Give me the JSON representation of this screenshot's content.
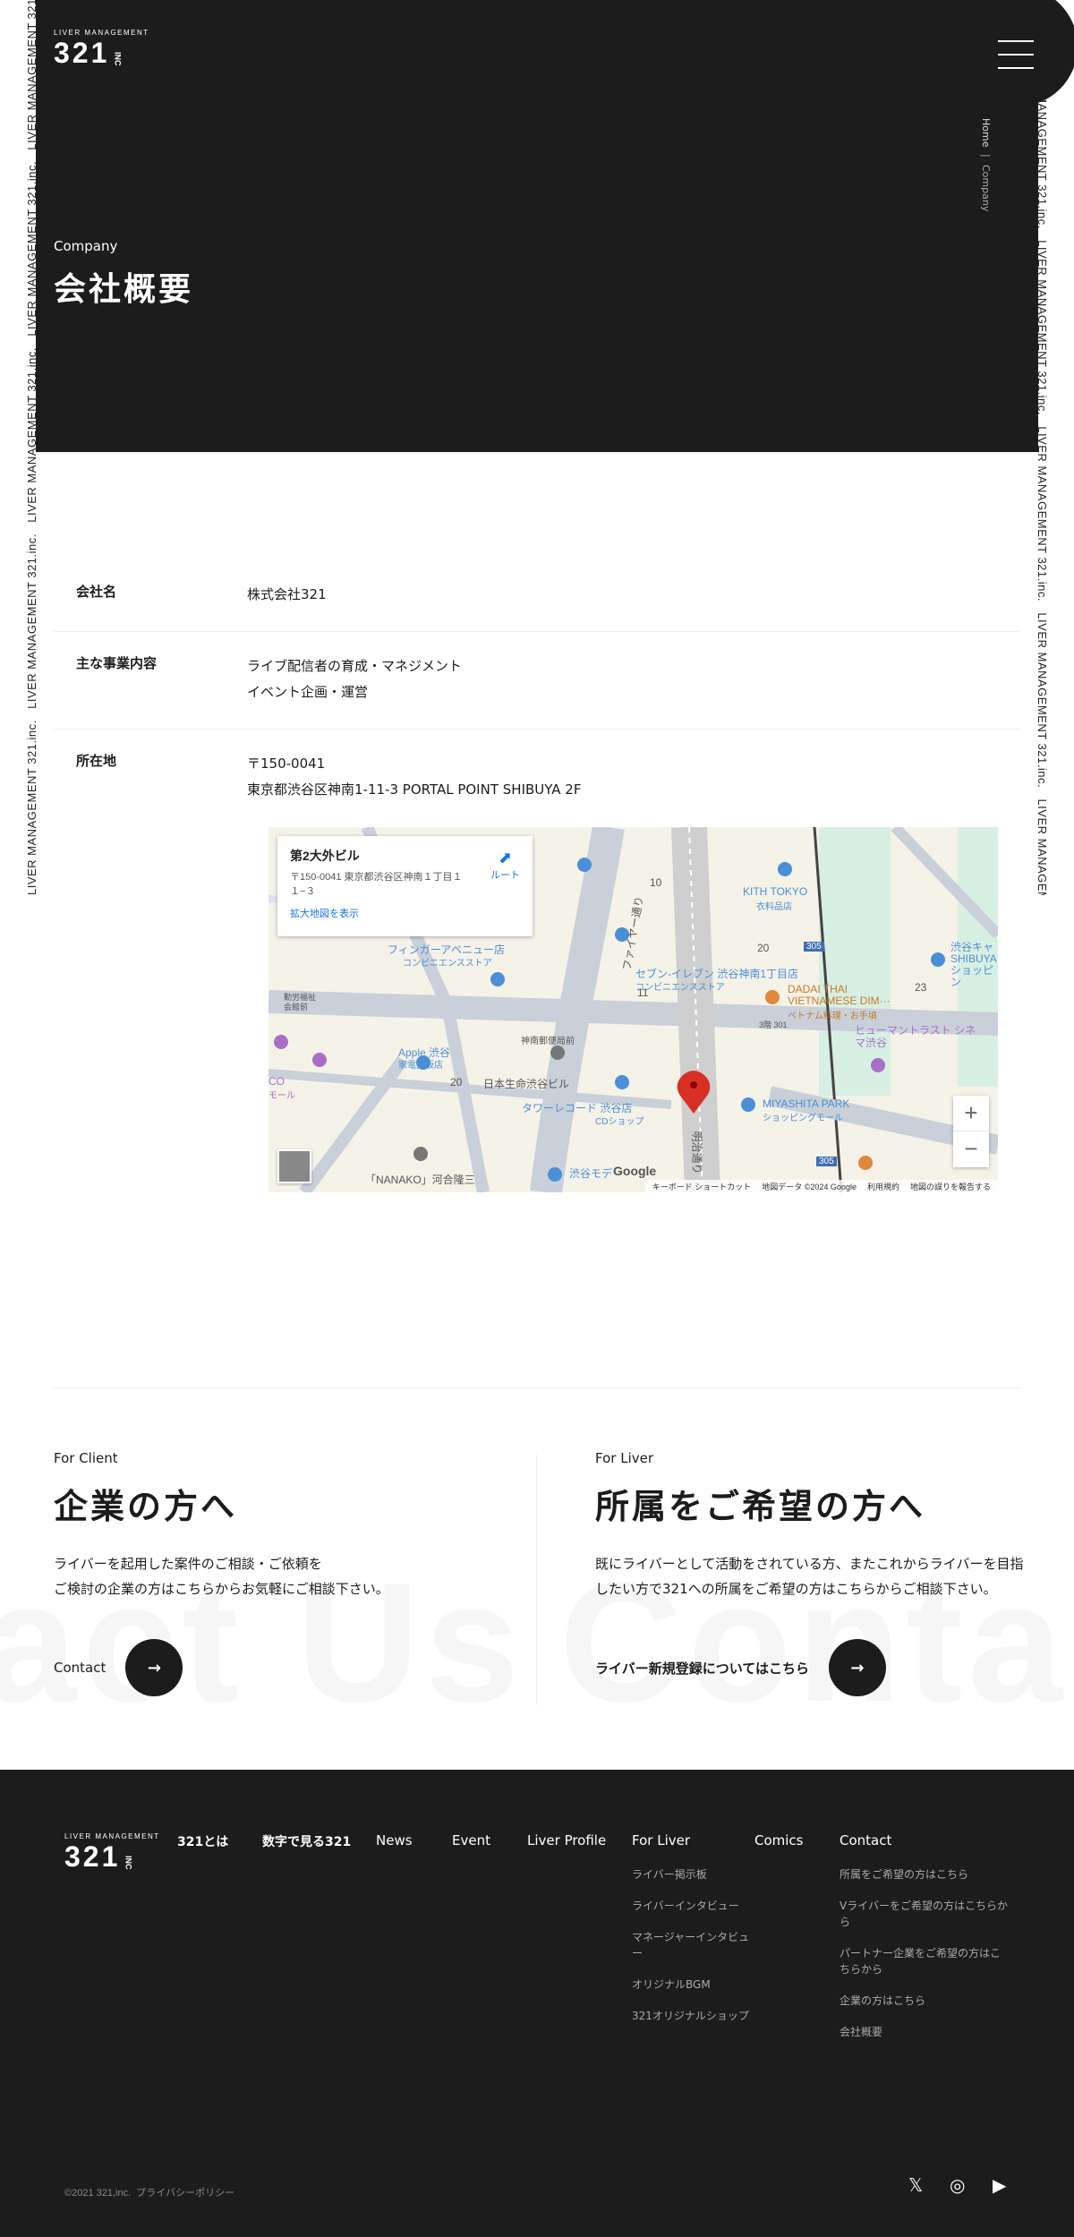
{
  "side_marquee": "LIVER MANAGEMENT 321,inc.",
  "brand": {
    "small": "LIVER MANAGEMENT",
    "name": "321",
    "suffix": "INC"
  },
  "hero": {
    "sub": "Company",
    "title": "会社概要"
  },
  "breadcrumb": {
    "home": "Home",
    "sep": "|",
    "current": "Company"
  },
  "company": {
    "rows": [
      {
        "label": "会社名",
        "lines": [
          "株式会社321"
        ]
      },
      {
        "label": "主な事業内容",
        "lines": [
          "ライブ配信者の育成・マネジメント",
          "イベント企画・運営"
        ]
      },
      {
        "label": "所在地",
        "lines": [
          "〒150-0041",
          "東京都渋谷区神南1-11-3 PORTAL POINT SHIBUYA 2F"
        ]
      }
    ]
  },
  "map": {
    "place": "第2大外ビル",
    "address": "〒150-0041 東京都渋谷区神南１丁目１１−３",
    "enlarge": "拡大地図を表示",
    "route": "ルート",
    "zoom_in": "+",
    "zoom_out": "−",
    "google": "Google",
    "footer": [
      "キーボード ショートカット",
      "地図データ ©2024 Google",
      "利用規約",
      "地図の誤りを報告する"
    ],
    "labels": {
      "seven": "セブン-イレブン 渋谷神南1丁目店",
      "seven_sub": "コンビニエンスストア",
      "finger": "フィンガーアベニュー店",
      "finger_sub": "コンビニエンスストア",
      "kith": "KITH TOKYO",
      "kith_sub": "衣料品店",
      "dadai": "DADAI THAI VIETNAMESE DIM···",
      "dadai_sub": "ベトナム料理・お手頃",
      "human": "ヒューマントラスト シネマ渋谷",
      "apple": "Apple 渋谷",
      "apple_sub": "家電量販店",
      "nissay": "日本生命渋谷ビル",
      "tower": "タワーレコード 渋谷店",
      "tower_sub": "CDショップ",
      "miyashita": "MIYASHITA PARK",
      "miyashita_sub": "ショッピングモール",
      "nanako": "「NANAKO」河合隆三",
      "jinnan": "神南郵便局前",
      "fire": "ファイヤー通り",
      "meiji": "明治通り",
      "route305a": "305",
      "route305b": "305",
      "n10": "10",
      "n11": "11",
      "n20a": "20",
      "n20b": "20",
      "n23": "23",
      "n301": "3階 301",
      "shibuya_kya": "渋谷キャ SHIBUYA ショッピン",
      "kinro": "勤労福祉会館前",
      "co": "CO",
      "co_sub": "モール",
      "modi": "渋谷モデ"
    }
  },
  "contact": {
    "bg_left": "act Us",
    "bg_right": "Conta",
    "client": {
      "en": "For Client",
      "title": "企業の方へ",
      "desc1": "ライバーを起用した案件のご相談・ご依頼を",
      "desc2": "ご検討の企業の方はこちらからお気軽にご相談下さい。",
      "cta": "Contact",
      "arrow": "→"
    },
    "liver": {
      "en": "For Liver",
      "title": "所属をご希望の方へ",
      "desc1": "既にライバーとして活動をされている方、またこれからライバーを目指",
      "desc2": "したい方で321への所属をご希望の方はこちらからご相談下さい。",
      "cta": "ライバー新規登録についてはこちら",
      "arrow": "→"
    }
  },
  "footer": {
    "nav": {
      "about": "321とは",
      "numbers": "数字で見る321",
      "news": "News",
      "event": "Event",
      "profile": "Liver Profile",
      "for_liver": "For Liver",
      "comics": "Comics",
      "contact": "Contact"
    },
    "for_liver_items": [
      "ライバー掲示板",
      "ライバーインタビュー",
      "マネージャーインタビュー",
      "オリジナルBGM",
      "321オリジナルショップ"
    ],
    "contact_items": [
      "所属をご希望の方はこちら",
      "Vライバーをご希望の方はこちらから",
      "パートナー企業をご希望の方はこちらから",
      "企業の方はこちら",
      "会社概要"
    ],
    "copyright": "©2021 321,inc.",
    "privacy": "プライバシーポリシー",
    "social": {
      "x": "𝕏",
      "instagram": "◎",
      "youtube": "▶"
    }
  }
}
